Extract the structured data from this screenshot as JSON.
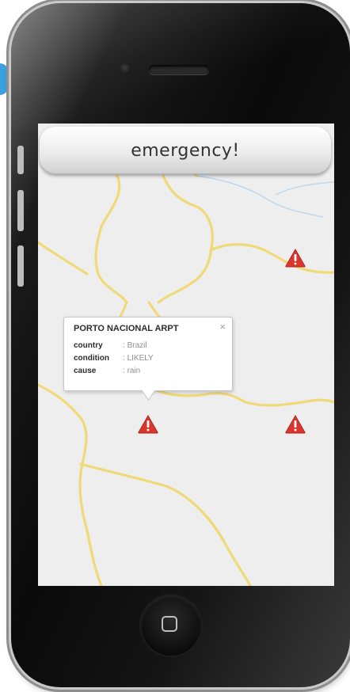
{
  "header": {
    "title": "emergency!"
  },
  "popup": {
    "title": "PORTO NACIONAL ARPT",
    "close_glyph": "×",
    "separator": ":",
    "rows": [
      {
        "key": "country",
        "value": "Brazil"
      },
      {
        "key": "condition",
        "value": "LIKELY"
      },
      {
        "key": "cause",
        "value": "rain"
      }
    ]
  },
  "map": {
    "marker_icon": "warning-triangle-icon",
    "marker_count": 3
  },
  "colors": {
    "road": "#f0da78",
    "river": "#bcd7ee",
    "marker_red": "#d9372e",
    "map_bg": "#eeeeee"
  }
}
